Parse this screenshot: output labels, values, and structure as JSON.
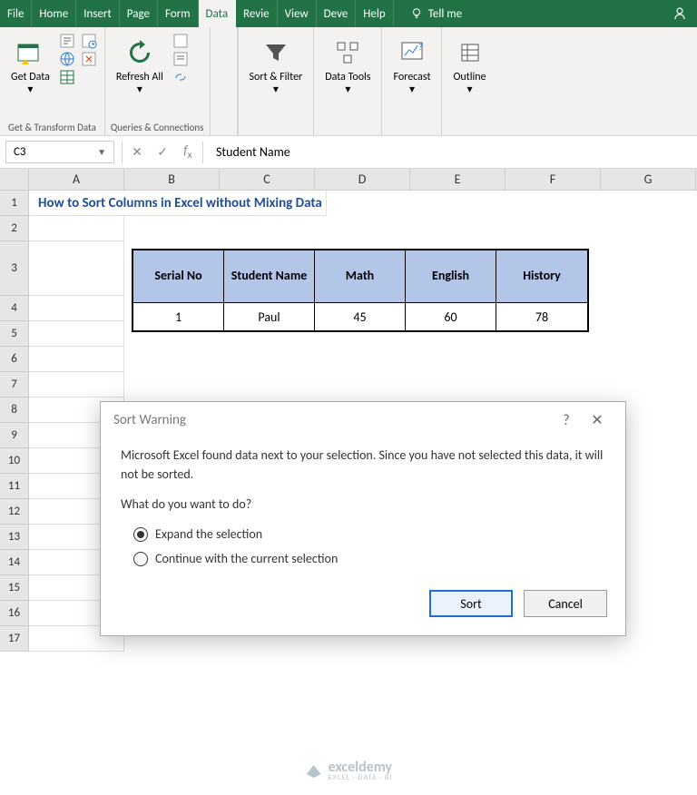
{
  "ribbon": {
    "tabs": [
      "File",
      "Home",
      "Insert",
      "Page",
      "Form",
      "Data",
      "Revie",
      "View",
      "Deve",
      "Help"
    ],
    "active_tab": "Data",
    "tell_me": "Tell me",
    "groups": {
      "get_transform": {
        "label": "Get & Transform Data",
        "get_data": "Get Data"
      },
      "queries": {
        "label": "Queries & Connections",
        "refresh": "Refresh All"
      },
      "sort_filter": {
        "label": "Sort & Filter"
      },
      "data_tools": {
        "label": "Data Tools"
      },
      "forecast": {
        "label": "Forecast"
      },
      "outline": {
        "label": "Outline"
      }
    }
  },
  "formula_bar": {
    "cell_ref": "C3",
    "value": "Student Name"
  },
  "columns": [
    "A",
    "B",
    "C",
    "D",
    "E",
    "F",
    "G"
  ],
  "row_numbers": [
    "1",
    "2",
    "3",
    "4",
    "5",
    "6",
    "7",
    "8",
    "9",
    "10",
    "11",
    "12",
    "13",
    "14",
    "15",
    "16",
    "17"
  ],
  "sheet": {
    "title": "How to Sort Columns in Excel without Mixing Data",
    "headers": [
      "Serial No",
      "Student Name",
      "Math",
      "English",
      "History"
    ],
    "rows": [
      [
        "1",
        "Paul",
        "45",
        "60",
        "78"
      ]
    ]
  },
  "dialog": {
    "title": "Sort Warning",
    "message": "Microsoft Excel found data next to your selection.  Since you have not selected this data, it will not be sorted.",
    "question": "What do you want to do?",
    "option1": "Expand the selection",
    "option2": "Continue with the current selection",
    "sort": "Sort",
    "cancel": "Cancel"
  },
  "watermark": {
    "name": "exceldemy",
    "sub": "EXCEL · DATA · BI"
  }
}
